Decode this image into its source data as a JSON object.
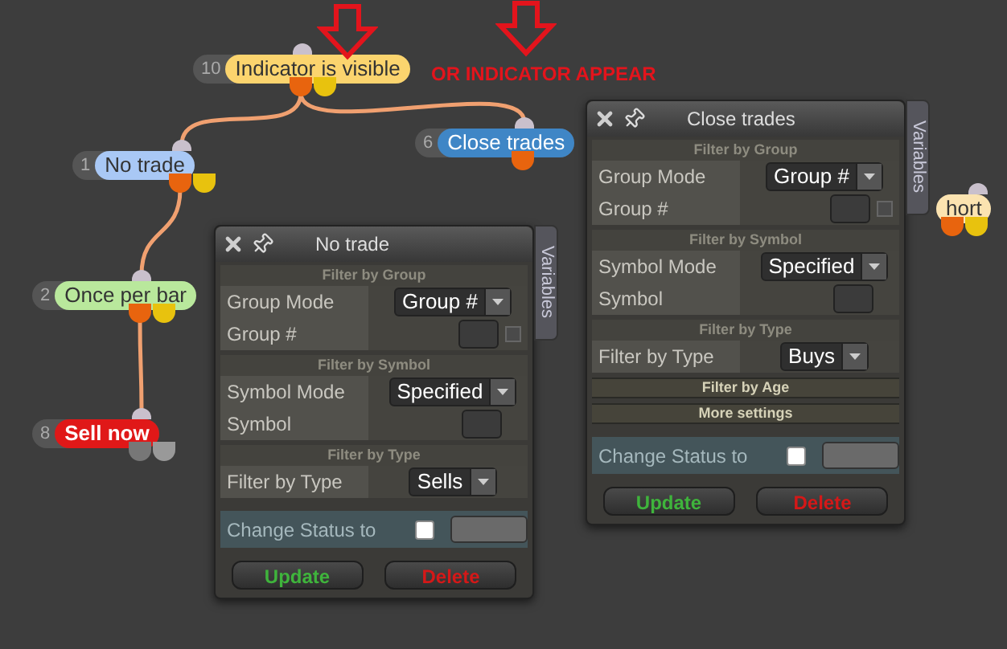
{
  "canvas": {
    "annotation": "OR INDICATOR APPEAR",
    "nodes": [
      {
        "number": "10",
        "label": "Indicator is visible",
        "color": "#fbd46e",
        "kind": "condition"
      },
      {
        "number": "1",
        "label": "No trade",
        "color": "#a9c8f5",
        "kind": "condition"
      },
      {
        "number": "6",
        "label": "Close trades",
        "color": "#3f86c6",
        "kind": "action"
      },
      {
        "number": "2",
        "label": "Once per bar",
        "color": "#b9e89c",
        "kind": "condition"
      },
      {
        "number": "8",
        "label": "Sell now",
        "color": "#e01818",
        "kind": "terminal"
      },
      {
        "label": "hort",
        "color": "#fbe3b0",
        "kind": "condition"
      }
    ]
  },
  "panels": [
    {
      "title": "Close trades",
      "side_tab": "Variables",
      "sections": [
        {
          "title": "Filter by Group",
          "expanded": true,
          "rows": [
            {
              "label": "Group Mode",
              "kind": "select",
              "value": "Group #"
            },
            {
              "label": "Group #",
              "kind": "input_check",
              "checked": false
            }
          ]
        },
        {
          "title": "Filter by Symbol",
          "expanded": true,
          "rows": [
            {
              "label": "Symbol Mode",
              "kind": "select",
              "value": "Specified"
            },
            {
              "label": "Symbol",
              "kind": "input"
            }
          ]
        },
        {
          "title": "Filter by Type",
          "expanded": true,
          "rows": [
            {
              "label": "Filter by Type",
              "kind": "select",
              "value": "Buys"
            }
          ]
        },
        {
          "title": "Filter by Age",
          "expanded": false
        },
        {
          "title": "More settings",
          "expanded": false
        }
      ],
      "status": {
        "label": "Change Status to",
        "checked": false
      },
      "buttons": [
        {
          "label": "Update",
          "kind": "ok"
        },
        {
          "label": "Delete",
          "kind": "danger"
        }
      ]
    },
    {
      "title": "No trade",
      "side_tab": "Variables",
      "sections": [
        {
          "title": "Filter by Group",
          "expanded": true,
          "rows": [
            {
              "label": "Group Mode",
              "kind": "select",
              "value": "Group #"
            },
            {
              "label": "Group #",
              "kind": "input_check",
              "checked": false
            }
          ]
        },
        {
          "title": "Filter by Symbol",
          "expanded": true,
          "rows": [
            {
              "label": "Symbol Mode",
              "kind": "select",
              "value": "Specified"
            },
            {
              "label": "Symbol",
              "kind": "input"
            }
          ]
        },
        {
          "title": "Filter by Type",
          "expanded": true,
          "rows": [
            {
              "label": "Filter by Type",
              "kind": "select",
              "value": "Sells"
            }
          ]
        }
      ],
      "status": {
        "label": "Change Status to",
        "checked": false
      },
      "buttons": [
        {
          "label": "Update",
          "kind": "ok"
        },
        {
          "label": "Delete",
          "kind": "danger"
        }
      ]
    }
  ]
}
